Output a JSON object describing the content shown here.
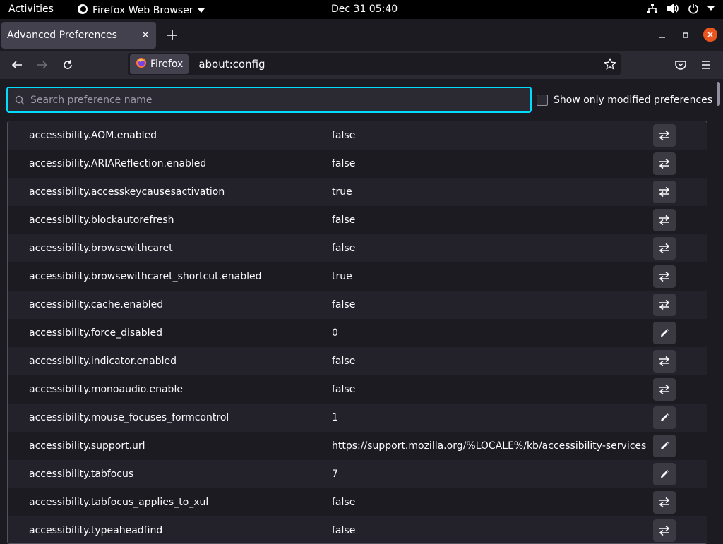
{
  "system_bar": {
    "activities": "Activities",
    "app_menu": "Firefox Web Browser",
    "clock": "Dec 31  05:40"
  },
  "tab": {
    "title": "Advanced Preferences"
  },
  "navbar": {
    "identity_label": "Firefox",
    "url": "about:config"
  },
  "search": {
    "placeholder": "Search preference name",
    "value": ""
  },
  "modified_filter": {
    "label": "Show only modified preferences",
    "checked": false
  },
  "preferences": [
    {
      "name": "accessibility.AOM.enabled",
      "value": "false",
      "action": "toggle"
    },
    {
      "name": "accessibility.ARIAReflection.enabled",
      "value": "false",
      "action": "toggle"
    },
    {
      "name": "accessibility.accesskeycausesactivation",
      "value": "true",
      "action": "toggle"
    },
    {
      "name": "accessibility.blockautorefresh",
      "value": "false",
      "action": "toggle"
    },
    {
      "name": "accessibility.browsewithcaret",
      "value": "false",
      "action": "toggle"
    },
    {
      "name": "accessibility.browsewithcaret_shortcut.enabled",
      "value": "true",
      "action": "toggle"
    },
    {
      "name": "accessibility.cache.enabled",
      "value": "false",
      "action": "toggle"
    },
    {
      "name": "accessibility.force_disabled",
      "value": "0",
      "action": "edit"
    },
    {
      "name": "accessibility.indicator.enabled",
      "value": "false",
      "action": "toggle"
    },
    {
      "name": "accessibility.monoaudio.enable",
      "value": "false",
      "action": "toggle"
    },
    {
      "name": "accessibility.mouse_focuses_formcontrol",
      "value": "1",
      "action": "edit"
    },
    {
      "name": "accessibility.support.url",
      "value": "https://support.mozilla.org/%LOCALE%/kb/accessibility-services",
      "action": "edit"
    },
    {
      "name": "accessibility.tabfocus",
      "value": "7",
      "action": "edit"
    },
    {
      "name": "accessibility.tabfocus_applies_to_xul",
      "value": "false",
      "action": "toggle"
    },
    {
      "name": "accessibility.typeaheadfind",
      "value": "false",
      "action": "toggle"
    }
  ],
  "colors": {
    "focus_ring": "#00ddff",
    "close_button": "#e9541f"
  }
}
